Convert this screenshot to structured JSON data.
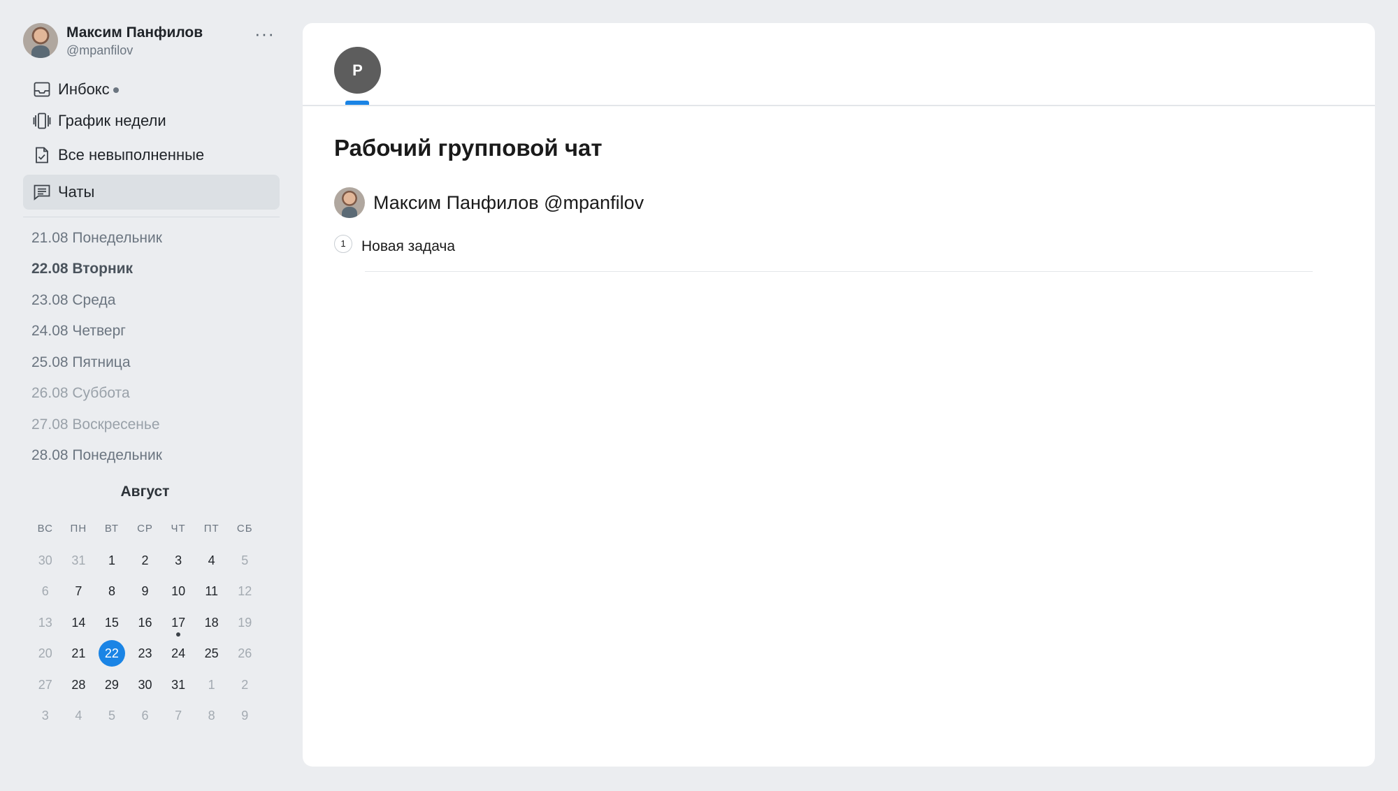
{
  "profile": {
    "name": "Максим Панфилов",
    "handle": "@mpanfilov",
    "more": "···"
  },
  "nav": [
    {
      "label": "Инбокс",
      "icon": "inbox-icon",
      "has_dot": true
    },
    {
      "label": "График недели",
      "icon": "week-schedule-icon"
    },
    {
      "label": "Все невыполненные",
      "icon": "checklist-document-icon"
    },
    {
      "label": "Чаты",
      "icon": "chat-icon",
      "active": true
    }
  ],
  "days": [
    {
      "label": "21.08 Понедельник"
    },
    {
      "label": "22.08 Вторник",
      "today": true
    },
    {
      "label": "23.08 Среда"
    },
    {
      "label": "24.08 Четверг"
    },
    {
      "label": "25.08 Пятница"
    },
    {
      "label": "26.08 Суббота",
      "weekend": true
    },
    {
      "label": "27.08 Воскресенье",
      "weekend": true
    },
    {
      "label": "28.08 Понедельник"
    }
  ],
  "calendar": {
    "month": "Август",
    "weekdays": [
      "ВС",
      "ПН",
      "ВТ",
      "СР",
      "ЧТ",
      "ПТ",
      "СБ"
    ],
    "weeks": [
      [
        "30",
        "31",
        "1",
        "2",
        "3",
        "4",
        "5"
      ],
      [
        "6",
        "7",
        "8",
        "9",
        "10",
        "11",
        "12"
      ],
      [
        "13",
        "14",
        "15",
        "16",
        "17",
        "18",
        "19"
      ],
      [
        "20",
        "21",
        "22",
        "23",
        "24",
        "25",
        "26"
      ],
      [
        "27",
        "28",
        "29",
        "30",
        "31",
        "1",
        "2"
      ],
      [
        "3",
        "4",
        "5",
        "6",
        "7",
        "8",
        "9"
      ]
    ],
    "selected_day": "22",
    "marked_day": "17"
  },
  "tab": {
    "initial": "P"
  },
  "chat": {
    "title": "Рабочий групповой чат",
    "member": "Максим Панфилов @mpanfilov",
    "task_number": "1",
    "task_text": "Новая задача"
  },
  "colors": {
    "accent": "#1a84e5",
    "background": "#ebedf0",
    "panel": "#ffffff"
  }
}
